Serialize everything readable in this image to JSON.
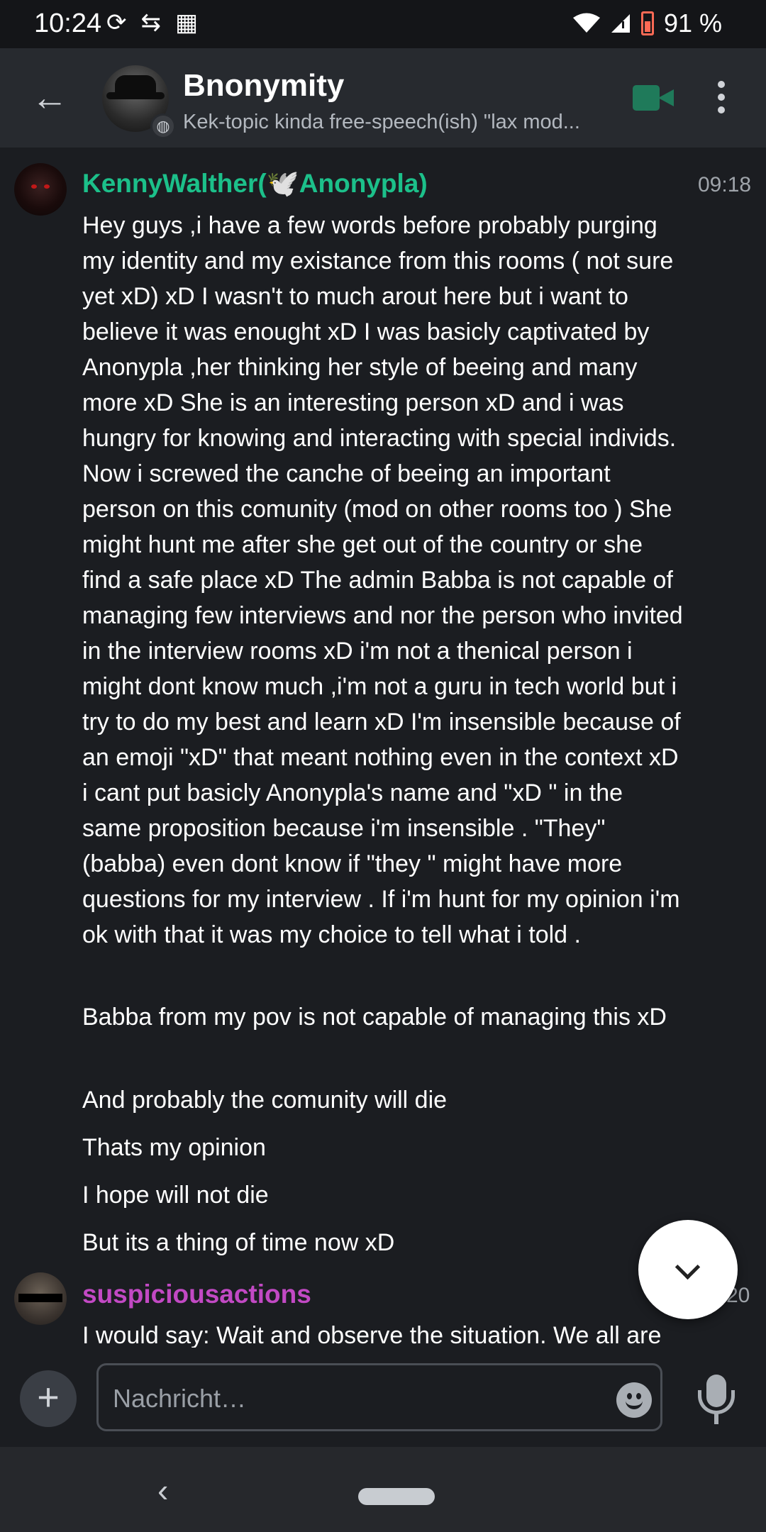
{
  "status_bar": {
    "time": "10:24",
    "left_icons": [
      "sync-icon",
      "data-transfer-icon",
      "grid-app-icon"
    ],
    "right_icons": [
      "wifi-icon",
      "signal-icon",
      "battery-icon"
    ],
    "battery_percent": "91 %"
  },
  "header": {
    "back_icon": "arrow-left-icon",
    "room_name": "Bnonymity",
    "room_topic": "Kek-topic kinda free-speech(ish) \"lax mod...",
    "video_call_icon": "video-camera-icon",
    "more_icon": "more-vertical-icon"
  },
  "messages": [
    {
      "sender": "KennyWalther(🕊️Anonypla)",
      "time": "09:18",
      "color": "#1cc08a",
      "paragraphs": [
        "Hey guys ,i have a few words before probably purging my identity and my existance from this rooms ( not sure yet xD) xD I wasn't to much arout here but i want to believe it was enought xD I was basicly captivated by Anonypla ,her thinking her style of beeing and many more xD She is an interesting person xD and i was hungry for knowing and interacting with special individs. Now i screwed the canche of beeing an important person on this comunity (mod on other rooms too ) She might hunt me after she get out of the country or she find a safe place xD The admin Babba is not capable of managing few interviews and nor the person who invited in the interview rooms xD i'm not a thenical person i might dont know much ,i'm not a guru in tech world but i try to do my best and learn xD I'm insensible because of an emoji \"xD\" that meant nothing even in the context xD i cant put basicly Anonypla's name and \"xD \" in the same proposition because i'm insensible . \"They\" (babba) even dont know if \"they \" might have more questions for my interview . If i'm hunt for my opinion i'm ok with that it was my choice to tell what i told .",
        "Babba from my pov is not capable of managing this xD",
        "And probably the comunity will die",
        "Thats my opinion",
        "I hope will not die",
        "But its a thing of time now xD"
      ]
    },
    {
      "sender": "suspiciousactions",
      "time": "20",
      "color": "#c249c4",
      "paragraphs": [
        "I would say: Wait and observe the situation. We all are"
      ]
    }
  ],
  "scroll_button_icon": "chevron-down-icon",
  "composer": {
    "attach_icon": "plus-icon",
    "placeholder": "Nachricht…",
    "emoji_icon": "emoji-icon",
    "mic_icon": "microphone-icon"
  },
  "nav_bar": {
    "back_icon": "chevron-left-icon",
    "home_icon": "home-pill-icon"
  }
}
